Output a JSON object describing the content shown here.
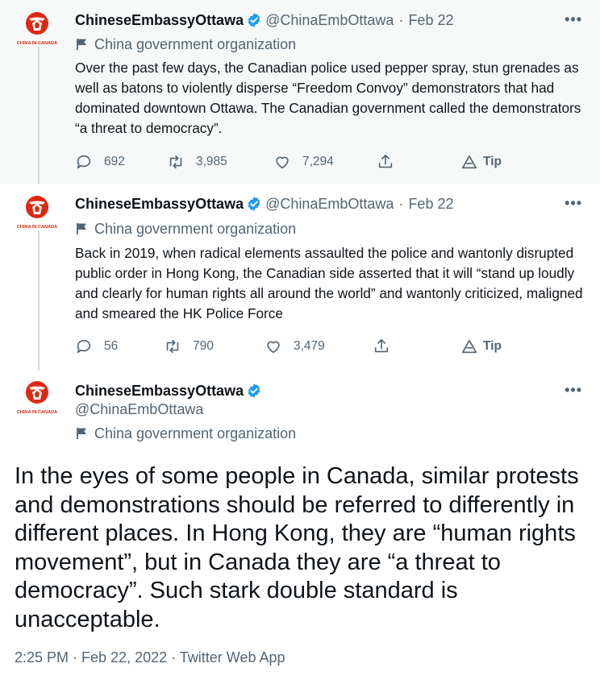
{
  "tweets": [
    {
      "display_name": "ChineseEmbassyOttawa",
      "handle": "@ChinaEmbOttawa",
      "separator": "·",
      "date": "Feb 22",
      "label": "China government organization",
      "avatar_caption": "CHINA IN CANADA",
      "text": "Over the past few days, the Canadian police used pepper spray, stun grenades as well as batons to violently disperse “Freedom Convoy” demonstrators that had dominated downtown Ottawa. The Canadian government called the demonstrators “a threat to democracy”.",
      "replies": "692",
      "retweets": "3,985",
      "likes": "7,294",
      "tip_label": "Tip"
    },
    {
      "display_name": "ChineseEmbassyOttawa",
      "handle": "@ChinaEmbOttawa",
      "separator": "·",
      "date": "Feb 22",
      "label": "China government organization",
      "avatar_caption": "CHINA IN CANADA",
      "text": "Back in 2019, when radical elements assaulted the police and wantonly disrupted public order in Hong Kong, the Canadian side asserted that it will “stand up loudly and clearly for human rights all around the world” and wantonly criticized, maligned and smeared the HK Police Force",
      "replies": "56",
      "retweets": "790",
      "likes": "3,479",
      "tip_label": "Tip"
    }
  ],
  "main_tweet": {
    "display_name": "ChineseEmbassyOttawa",
    "handle": "@ChinaEmbOttawa",
    "label": "China government organization",
    "avatar_caption": "CHINA IN CANADA",
    "text": "In the eyes of some people in Canada, similar protests and demonstrations should be referred to differently in different places. In Hong Kong, they are “human rights movement”, but in Canada they are “a threat to democracy”. Such stark double standard is unacceptable.",
    "timestamp": "2:25 PM · Feb 22, 2022 · Twitter Web App"
  },
  "colors": {
    "text_primary": "#0f1419",
    "text_secondary": "#536471",
    "verified_blue": "#1d9bf0",
    "highlight_bg": "#f7f9f9",
    "thread_line": "#cfd9de",
    "avatar_red": "#de2910",
    "avatar_yellow": "#ffde00"
  },
  "icons": {
    "verified": "verified-badge-icon",
    "label": "flag-icon",
    "reply": "reply-icon",
    "retweet": "retweet-icon",
    "like": "heart-icon",
    "share": "share-icon",
    "tip": "tip-icon",
    "more": "more-icon"
  },
  "more_glyph": "•••"
}
